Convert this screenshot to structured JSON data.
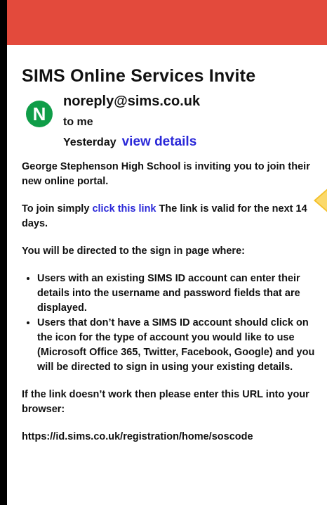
{
  "email": {
    "title": "SIMS Online Services Invite",
    "avatar_letter": "N",
    "from": "noreply@sims.co.uk",
    "to": "to me",
    "date": "Yesterday",
    "view_details": "view details",
    "para1": "George Stephenson High School is inviting you to join their new online portal.",
    "para2_prefix": "To join simply ",
    "para2_link": "click this link",
    "para2_suffix": " The link is valid for the next 14 days.",
    "para3": "You will be directed to the sign in page where:",
    "bullets": [
      "Users with an existing SIMS ID account can enter their details into the username and password fields that are displayed.",
      "Users that don’t have a SIMS ID account should click on the icon for the type of account you would like to use (Microsoft Office 365, Twitter, Facebook, Google) and you will be directed to sign in using your existing details."
    ],
    "para4": "If the link doesn’t work then please enter this URL into your browser:",
    "url": "https://id.sims.co.uk/registration/home/soscode"
  },
  "colors": {
    "header_red": "#e34a3c",
    "avatar_green": "#0f9d48",
    "link_blue": "#2a28d8",
    "arrow_yellow": "#f4c12c"
  },
  "icons": {
    "callout": "pointer-arrow-icon"
  }
}
